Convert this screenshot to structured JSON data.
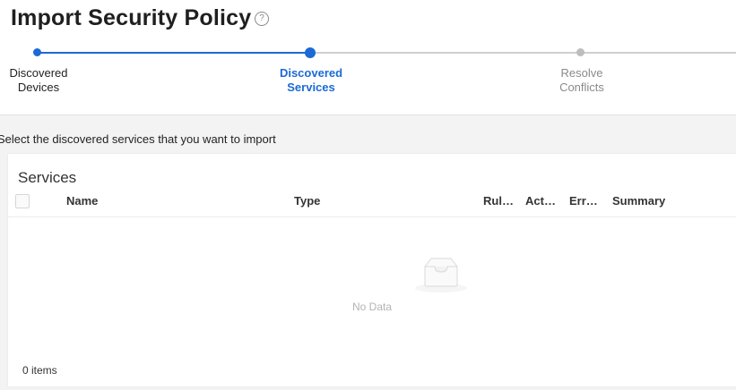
{
  "page": {
    "title": "Import Security Policy",
    "help_icon": "?"
  },
  "wizard": {
    "steps": [
      {
        "line1": "Discovered",
        "line2": "Devices",
        "state": "completed"
      },
      {
        "line1": "Discovered",
        "line2": "Services",
        "state": "active"
      },
      {
        "line1": "Resolve",
        "line2": "Conflicts",
        "state": "pending"
      }
    ]
  },
  "instruction": "Select the discovered services that you want to import",
  "services": {
    "title": "Services",
    "columns": [
      "Name",
      "Type",
      "Rul…",
      "Act…",
      "Err…",
      "Summary"
    ],
    "empty_text": "No Data",
    "footer": "0 items"
  },
  "colors": {
    "accent": "#1b6ad6",
    "pending": "#bdbdbd"
  }
}
